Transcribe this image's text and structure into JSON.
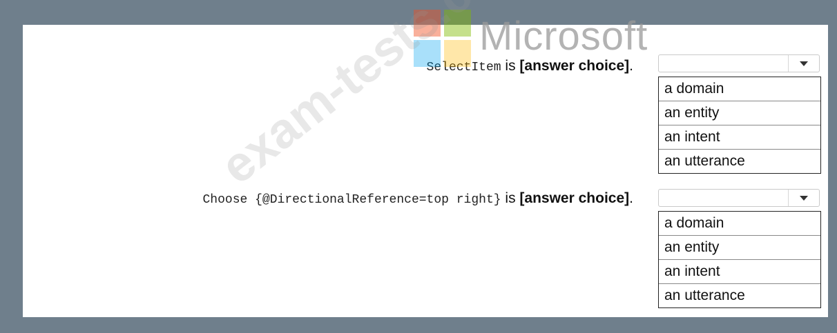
{
  "logo": {
    "text": "Microsoft"
  },
  "watermark": {
    "text": "exam-tests.com"
  },
  "questions": [
    {
      "code": "SelectItem",
      "is_text": " is ",
      "choice_placeholder": "[answer choice]",
      "period": ".",
      "selected_value": "",
      "options": [
        "a domain",
        "an entity",
        "an intent",
        "an utterance"
      ]
    },
    {
      "code": "Choose {@DirectionalReference=top right}",
      "is_text": " is ",
      "choice_placeholder": "[answer choice]",
      "period": ".",
      "selected_value": "",
      "options": [
        "a domain",
        "an entity",
        "an intent",
        "an utterance"
      ]
    }
  ]
}
